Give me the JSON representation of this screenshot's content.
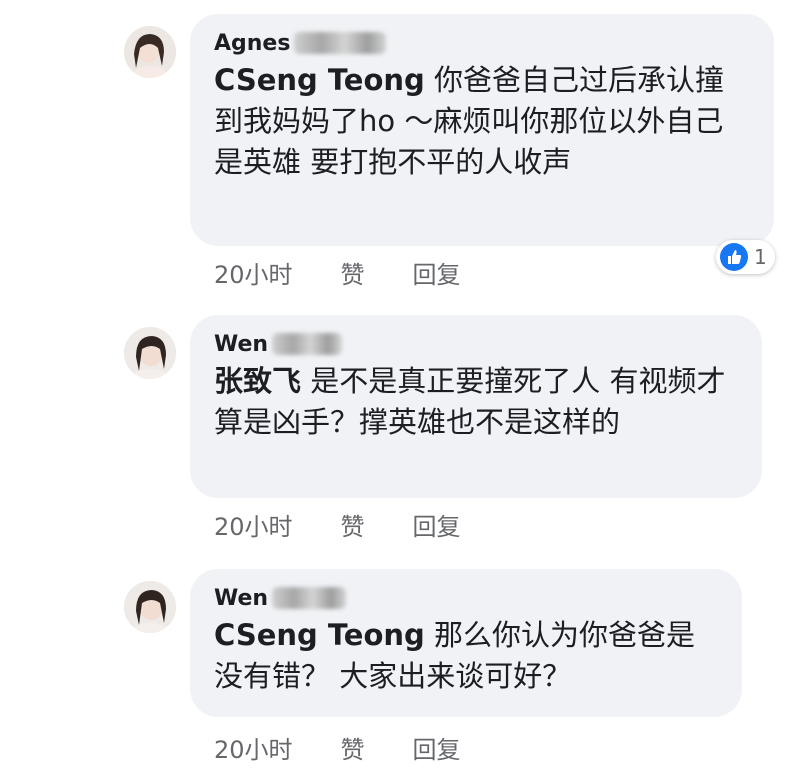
{
  "comments": [
    {
      "author": "Agnes",
      "mention": "CSeng Teong",
      "body": " 你爸爸自己过后承认撞到我妈妈了ho ～麻烦叫你那位以外自己是英雄 要打抱不平的人收声",
      "time": "20小时",
      "like_label": "赞",
      "reply_label": "回复",
      "reaction_count": "1"
    },
    {
      "author": "Wen",
      "mention": "张致飞",
      "body": " 是不是真正要撞死了人 有视频才算是凶手？撑英雄也不是这样的",
      "time": "20小时",
      "like_label": "赞",
      "reply_label": "回复"
    },
    {
      "author": "Wen",
      "mention": "CSeng Teong",
      "body": " 那么你认为你爸爸是没有错？ 大家出来谈可好？",
      "time": "20小时",
      "like_label": "赞",
      "reply_label": "回复"
    }
  ],
  "colors": {
    "bubble": "#f0f2f5",
    "like_blue": "#1877f2",
    "meta_text": "#65676b"
  }
}
